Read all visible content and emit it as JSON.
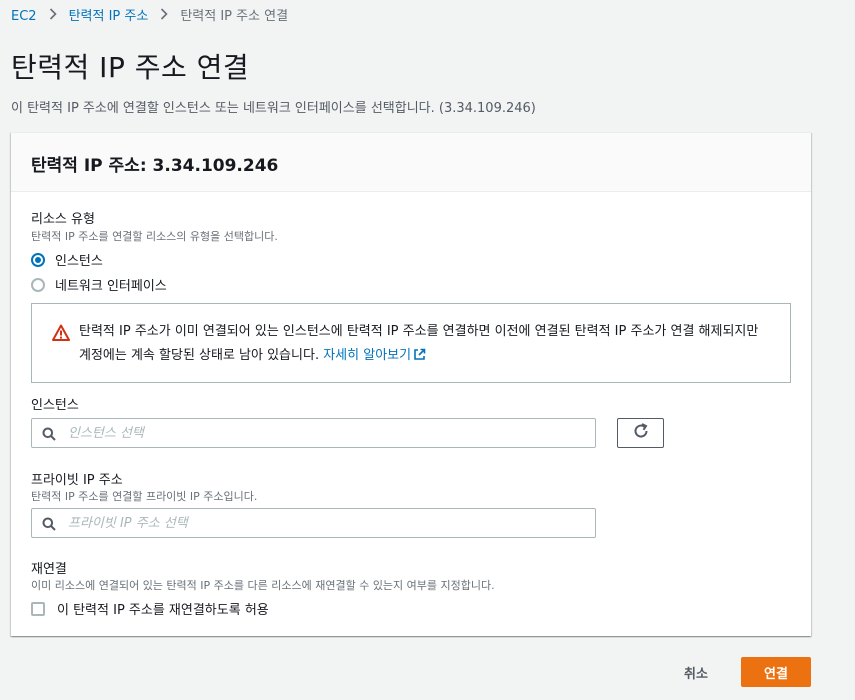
{
  "breadcrumb": {
    "items": [
      {
        "label": "EC2"
      },
      {
        "label": "탄력적 IP 주소"
      },
      {
        "label": "탄력적 IP 주소 연결"
      }
    ]
  },
  "page": {
    "title": "탄력적 IP 주소 연결",
    "description": "이 탄력적 IP 주소에 연결할 인스턴스 또는 네트워크 인터페이스를 선택합니다. (3.34.109.246)"
  },
  "panel": {
    "title": "탄력적 IP 주소: 3.34.109.246",
    "resource_type": {
      "label": "리소스 유형",
      "description": "탄력적 IP 주소를 연결할 리소스의 유형을 선택합니다.",
      "options": [
        {
          "label": "인스턴스",
          "selected": true
        },
        {
          "label": "네트워크 인터페이스",
          "selected": false
        }
      ]
    },
    "alert": {
      "text": "탄력적 IP 주소가 이미 연결되어 있는 인스턴스에 탄력적 IP 주소를 연결하면 이전에 연결된 탄력적 IP 주소가 연결 해제되지만 계정에는 계속 할당된 상태로 남아 있습니다.",
      "link": "자세히 알아보기",
      "color": "#d13212"
    },
    "instance": {
      "label": "인스턴스",
      "placeholder": "인스턴스 선택"
    },
    "private_ip": {
      "label": "프라이빗 IP 주소",
      "description": "탄력적 IP 주소를 연결할 프라이빗 IP 주소입니다.",
      "placeholder": "프라이빗 IP 주소 선택"
    },
    "reassociation": {
      "label": "재연결",
      "description": "이미 리소스에 연결되어 있는 탄력적 IP 주소를 다른 리소스에 재연결할 수 있는지 여부를 지정합니다.",
      "checkbox_label": "이 탄력적 IP 주소를 재연결하도록 허용",
      "checked": false
    }
  },
  "actions": {
    "cancel": "취소",
    "submit": "연결",
    "primary_color": "#ec7211"
  }
}
